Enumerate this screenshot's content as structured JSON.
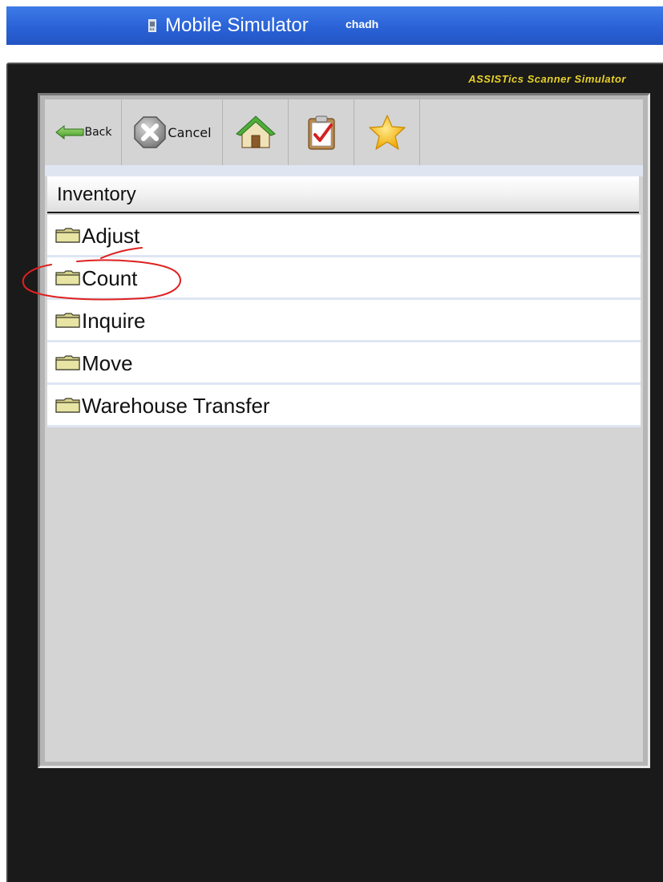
{
  "titlebar": {
    "icon": "mobile-phone-icon",
    "title": "Mobile Simulator",
    "user": "chadh"
  },
  "device": {
    "brand": "ASSISTics Scanner Simulator"
  },
  "toolbar": {
    "back_label": "Back",
    "cancel_label": "Cancel",
    "home_icon": "home-icon",
    "tasks_icon": "clipboard-check-icon",
    "favorites_icon": "star-icon"
  },
  "menu": {
    "title": "Inventory",
    "items": [
      {
        "label": "Adjust",
        "icon": "folder-icon"
      },
      {
        "label": "Count",
        "icon": "folder-icon"
      },
      {
        "label": "Inquire",
        "icon": "folder-icon"
      },
      {
        "label": "Move",
        "icon": "folder-icon"
      },
      {
        "label": "Warehouse Transfer",
        "icon": "folder-icon"
      }
    ]
  },
  "colors": {
    "titlebar_blue": "#2a62d6",
    "brand_yellow": "#e8d22a",
    "annotation_red": "#e02020"
  }
}
